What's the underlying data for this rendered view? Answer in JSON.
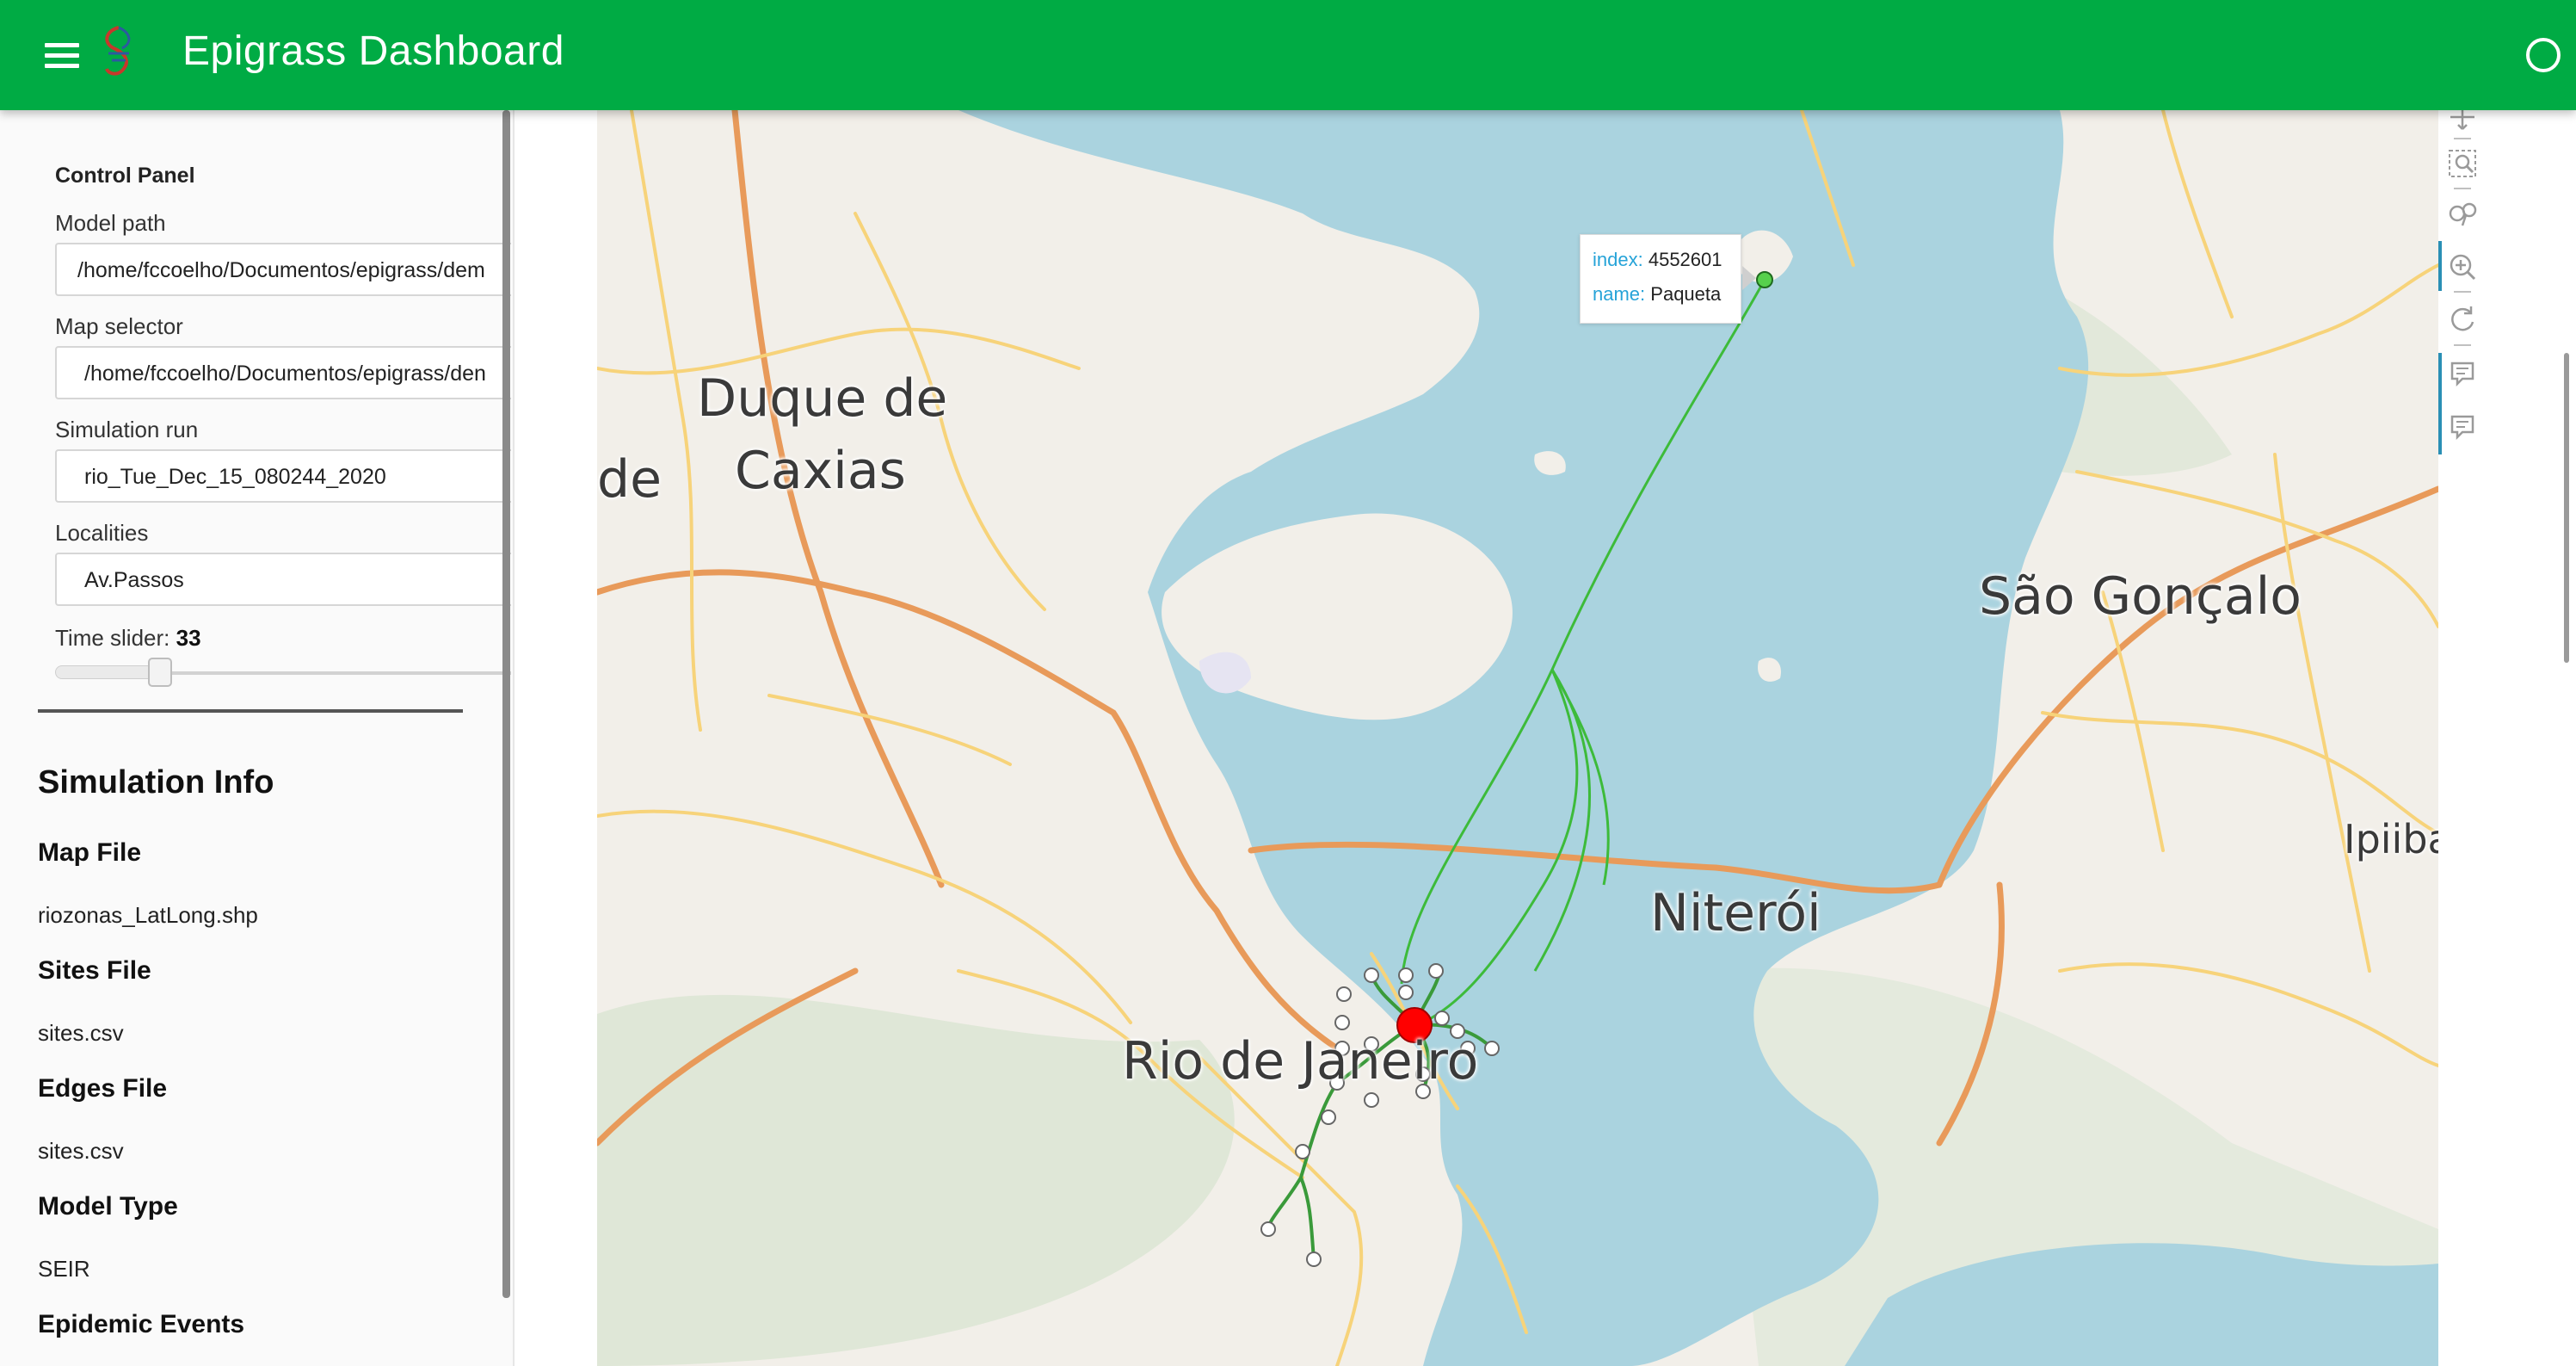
{
  "header": {
    "title": "Epigrass Dashboard",
    "colors": {
      "bar": "#00ab44",
      "text": "#ffffff"
    }
  },
  "control_panel": {
    "title": "Control Panel",
    "model_path": {
      "label": "Model path",
      "value": "/home/fccoelho/Documentos/epigrass/dem"
    },
    "map_selector": {
      "label": "Map selector",
      "value": "/home/fccoelho/Documentos/epigrass/den"
    },
    "simulation_run": {
      "label": "Simulation run",
      "value": "rio_Tue_Dec_15_080244_2020"
    },
    "localities": {
      "label": "Localities",
      "value": "Av.Passos"
    },
    "time_slider": {
      "label": "Time slider: ",
      "value": "33"
    }
  },
  "simulation_info": {
    "title": "Simulation Info",
    "items": [
      {
        "heading": "Map File",
        "value": "riozonas_LatLong.shp"
      },
      {
        "heading": "Sites File",
        "value": "sites.csv"
      },
      {
        "heading": "Edges File",
        "value": "sites.csv"
      },
      {
        "heading": "Model Type",
        "value": "SEIR"
      },
      {
        "heading": "Epidemic Events",
        "value": ""
      }
    ]
  },
  "map": {
    "labels": {
      "duque_1": "Duque de",
      "duque_2": "Caxias",
      "de": "de",
      "sao_goncalo": "São Gonçalo",
      "niteroi": "Niterói",
      "rio": "Rio de Janeiro",
      "ipiiba": "Ipiiba"
    },
    "tooltip": {
      "index_key": "index:",
      "index_val": "4552601",
      "name_key": "name:",
      "name_val": "Paqueta"
    },
    "colors": {
      "water": "#aad3df",
      "land": "#f2efe9",
      "edge": "#38b63a",
      "selected_node": "#ff0000"
    },
    "toolbar_icons": [
      "pan-icon",
      "box-zoom-icon",
      "lasso-icon",
      "wheel-zoom-icon",
      "reset-icon",
      "hover-icon",
      "hover-icon-2"
    ]
  }
}
